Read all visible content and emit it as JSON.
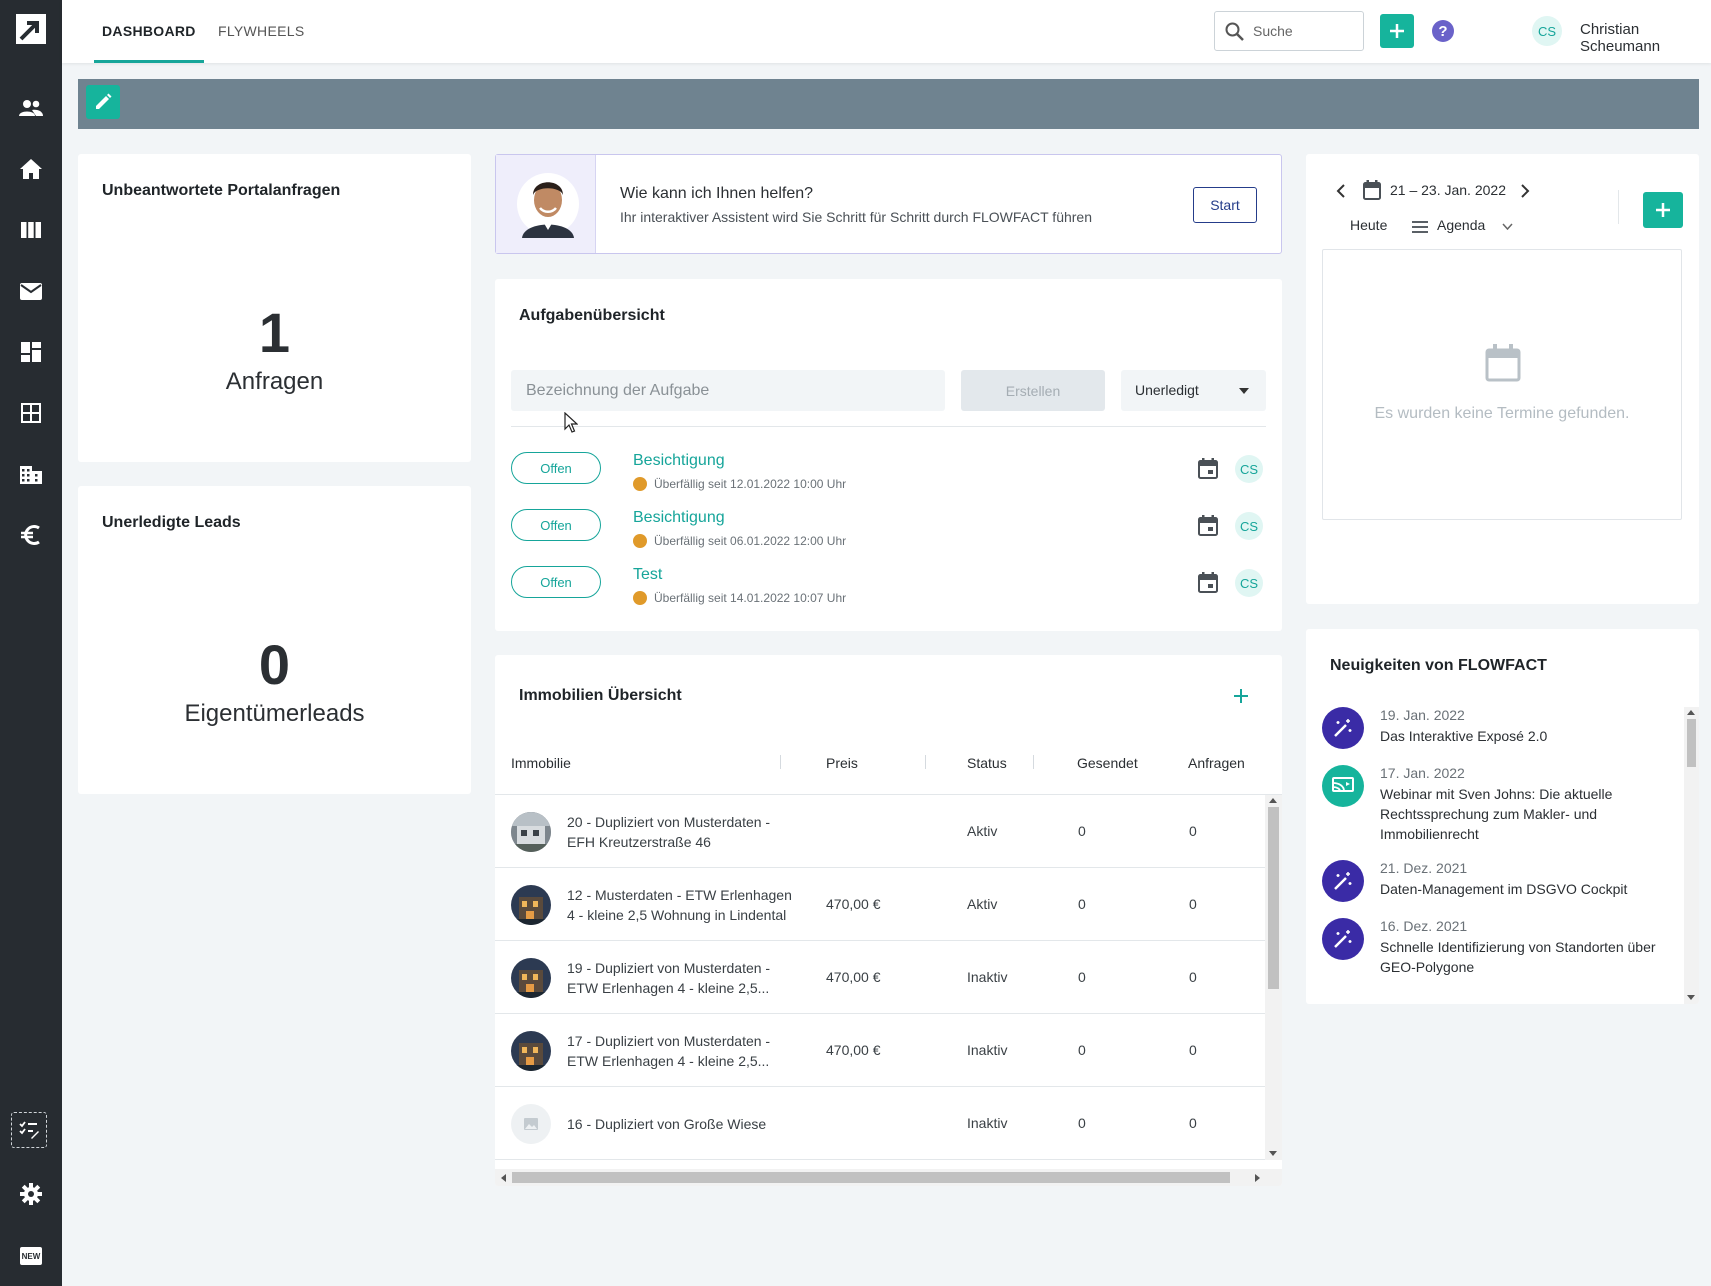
{
  "nav": {
    "tabs": [
      {
        "label": "DASHBOARD",
        "active": true
      },
      {
        "label": "FLYWHEELS",
        "active": false
      }
    ],
    "search_placeholder": "Suche",
    "user": {
      "initials": "CS",
      "name": "Christian Scheumann"
    }
  },
  "sidebar": {
    "items": [
      "logo-icon",
      "contacts-icon",
      "home-icon",
      "columns-icon",
      "mail-icon",
      "dashboard-icon",
      "grid-icon",
      "building-icon",
      "euro-icon",
      "checklist-icon",
      "settings-icon",
      "new-icon"
    ],
    "new_badge": "NEW"
  },
  "portal_card": {
    "title": "Unbeantwortete Portalanfragen",
    "count": "1",
    "label": "Anfragen"
  },
  "leads_card": {
    "title": "Unerledigte Leads",
    "count": "0",
    "label": "Eigentümerleads"
  },
  "assistant": {
    "heading": "Wie kann ich Ihnen helfen?",
    "subtext": "Ihr interaktiver Assistent wird Sie Schritt für Schritt durch FLOWFACT führen",
    "start_label": "Start"
  },
  "tasks": {
    "title": "Aufgabenübersicht",
    "input_placeholder": "Bezeichnung der Aufgabe",
    "create_label": "Erstellen",
    "filter_value": "Unerledigt",
    "items": [
      {
        "status": "Offen",
        "title": "Besichtigung",
        "due": "Überfällig seit 12.01.2022 10:00 Uhr",
        "assignee": "CS"
      },
      {
        "status": "Offen",
        "title": "Besichtigung",
        "due": "Überfällig seit 06.01.2022 12:00 Uhr",
        "assignee": "CS"
      },
      {
        "status": "Offen",
        "title": "Test",
        "due": "Überfällig seit 14.01.2022 10:07 Uhr",
        "assignee": "CS"
      }
    ]
  },
  "properties": {
    "title": "Immobilien Übersicht",
    "columns": [
      "Immobilie",
      "Preis",
      "Status",
      "Gesendet",
      "Anfragen"
    ],
    "rows": [
      {
        "name": "20 - Dupliziert von Musterdaten - EFH Kreutzerstraße 46",
        "price": "",
        "status": "Aktiv",
        "sent": "0",
        "requests": "0",
        "thumb": "house"
      },
      {
        "name": "12 - Musterdaten - ETW Erlenhagen 4 - kleine 2,5 Wohnung in Lindental",
        "price": "470,00 €",
        "status": "Aktiv",
        "sent": "0",
        "requests": "0",
        "thumb": "night"
      },
      {
        "name": "19 - Dupliziert von Musterdaten - ETW Erlenhagen 4 - kleine 2,5...",
        "price": "470,00 €",
        "status": "Inaktiv",
        "sent": "0",
        "requests": "0",
        "thumb": "night"
      },
      {
        "name": "17 - Dupliziert von Musterdaten - ETW Erlenhagen 4 - kleine 2,5...",
        "price": "470,00 €",
        "status": "Inaktiv",
        "sent": "0",
        "requests": "0",
        "thumb": "night"
      },
      {
        "name": "16 - Dupliziert von Große Wiese",
        "price": "",
        "status": "Inaktiv",
        "sent": "0",
        "requests": "0",
        "thumb": "placeholder"
      }
    ]
  },
  "calendar": {
    "range": "21 – 23. Jan. 2022",
    "today_label": "Heute",
    "view_label": "Agenda",
    "empty_text": "Es wurden keine Termine gefunden."
  },
  "news": {
    "title": "Neuigkeiten von FLOWFACT",
    "items": [
      {
        "date": "19. Jan. 2022",
        "title": "Das Interaktive Exposé 2.0",
        "icon": "magic-wand-icon"
      },
      {
        "date": "17. Jan. 2022",
        "title": "Webinar mit Sven Johns: Die aktuelle Rechtssprechung zum Makler- und Immobilienrecht",
        "icon": "webinar-icon"
      },
      {
        "date": "21. Dez. 2021",
        "title": "Daten-Management im DSGVO Cockpit",
        "icon": "magic-wand-icon"
      },
      {
        "date": "16. Dez. 2021",
        "title": "Schnelle Identifizierung von Standorten über GEO-Polygone",
        "icon": "magic-wand-icon"
      }
    ]
  },
  "colors": {
    "accent": "#16b49c",
    "sidebar": "#272c31",
    "header_strip": "#6f8390",
    "news_purple": "#3a2ba6",
    "warning": "#e09a2a"
  }
}
